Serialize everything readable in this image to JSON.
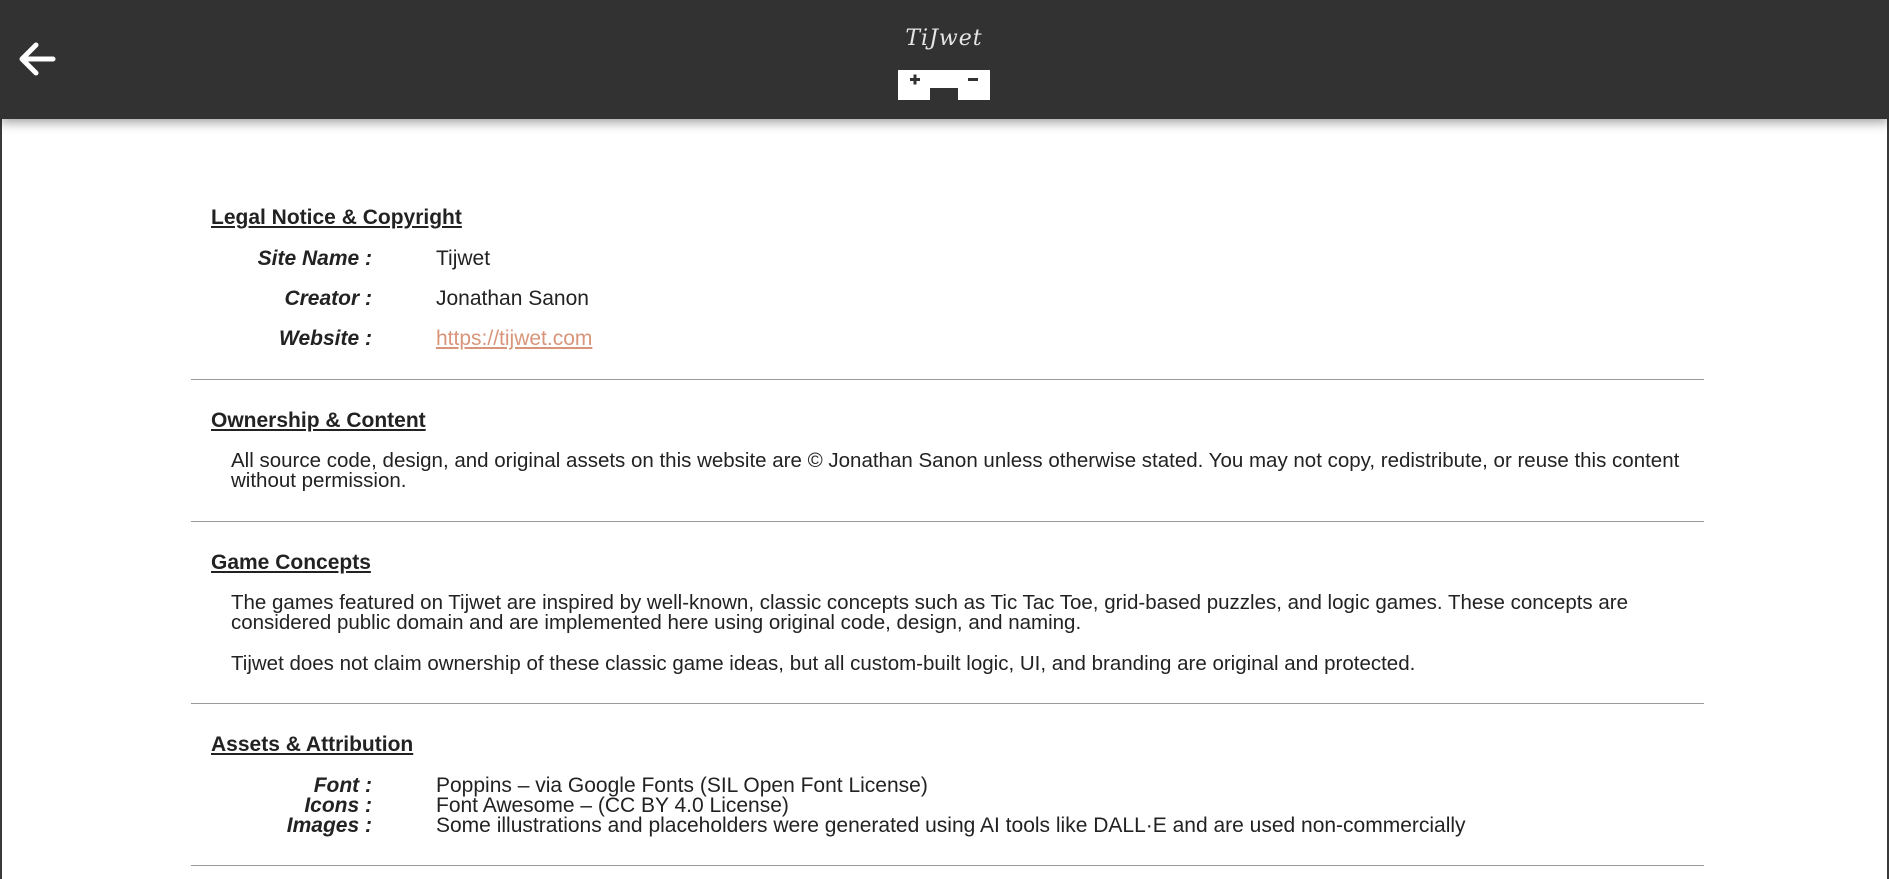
{
  "header": {
    "logo_text": "TiJwet",
    "back_icon": "arrow-left-icon",
    "colors": {
      "background": "#323232",
      "accent": "#d9957a"
    }
  },
  "legal": {
    "title": "Legal Notice & Copyright",
    "rows": [
      {
        "label": "Site Name :",
        "value": "Tijwet"
      },
      {
        "label": "Creator :",
        "value": "Jonathan Sanon"
      },
      {
        "label": "Website :",
        "value": "https://tijwet.com"
      }
    ]
  },
  "ownership": {
    "title": "Ownership & Content",
    "text": "All source code, design, and original assets on this website are © Jonathan Sanon unless otherwise stated. You may not copy, redistribute, or reuse this content without permission."
  },
  "game_concepts": {
    "title": "Game Concepts",
    "paragraphs": [
      "The games featured on Tijwet are inspired by well-known, classic concepts such as Tic Tac Toe, grid-based puzzles, and logic games. These concepts are considered public domain and are implemented here using original code, design, and naming.",
      "Tijwet does not claim ownership of these classic game ideas, but all custom-built logic, UI, and branding are original and protected."
    ]
  },
  "assets": {
    "title": "Assets & Attribution",
    "rows": [
      {
        "label": "Font :",
        "value": "Poppins – via Google Fonts (SIL Open Font License)"
      },
      {
        "label": "Icons :",
        "value": "Font Awesome – (CC BY 4.0 License)"
      },
      {
        "label": "Images :",
        "value": "Some illustrations and placeholders were generated using AI tools like DALL·E and are used non-commercially"
      }
    ]
  }
}
